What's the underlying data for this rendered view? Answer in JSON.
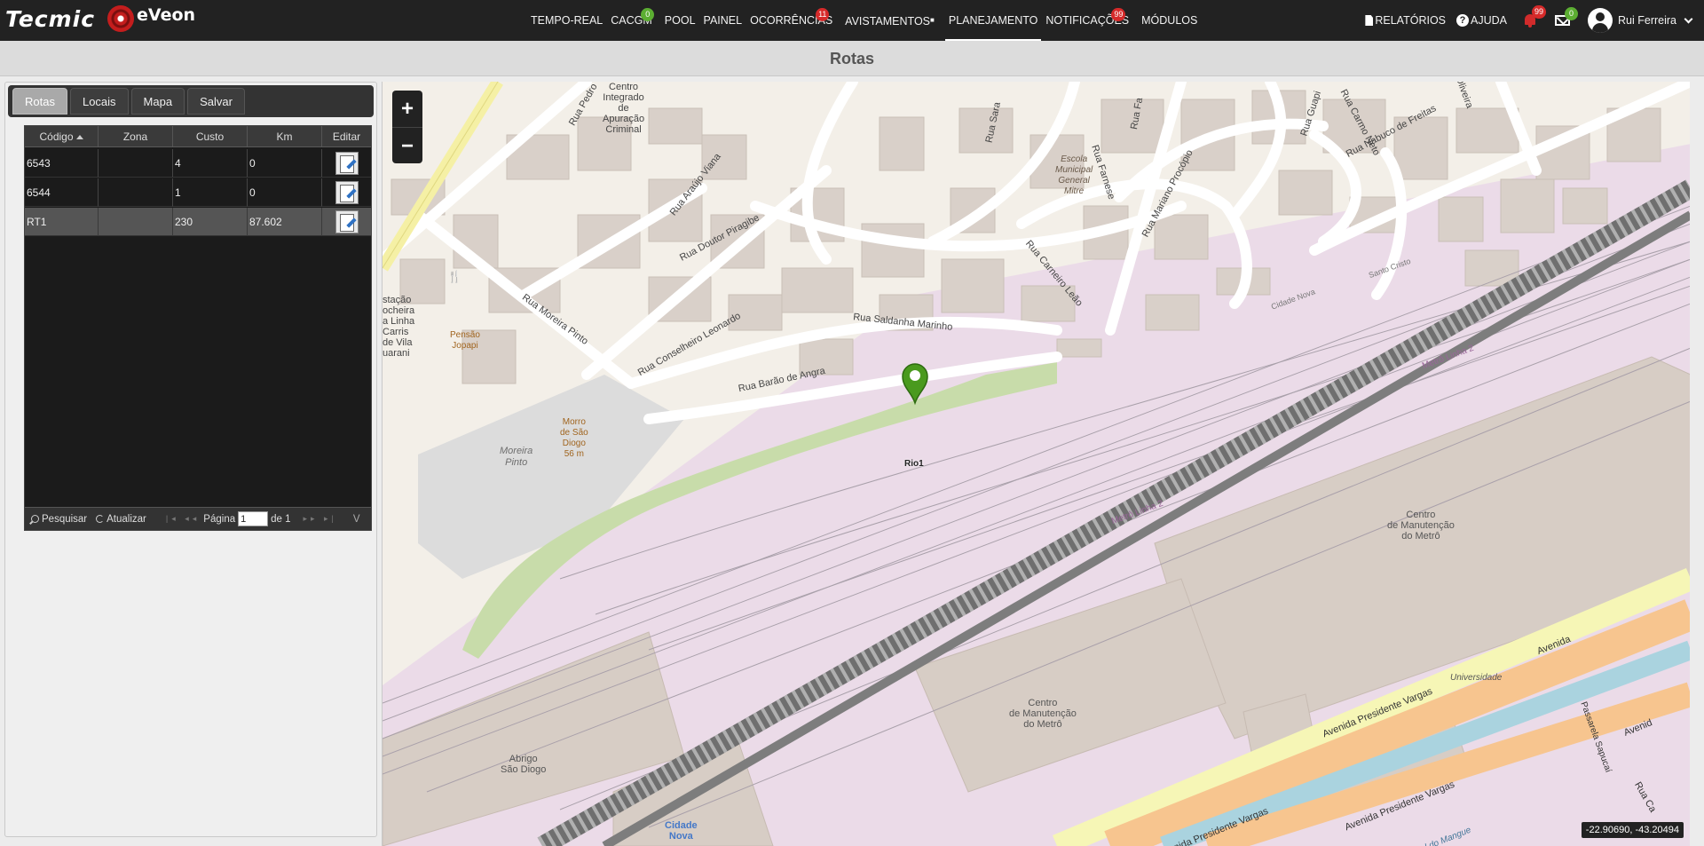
{
  "brand": {
    "tecmic": "Tecmic",
    "eveon": "eVeon"
  },
  "nav": {
    "items": [
      {
        "id": "tempo-real",
        "label": "TEMPO-REAL",
        "badge": ""
      },
      {
        "id": "cacgm",
        "label": "CACGM",
        "badge": "0"
      },
      {
        "id": "pool",
        "label": "POOL",
        "badge": ""
      },
      {
        "id": "painel",
        "label": "PAINEL",
        "badge": ""
      },
      {
        "id": "ocorrencias",
        "label": "OCORRÊNCIAS",
        "badge": "11"
      },
      {
        "id": "avistamentos",
        "label": "AVISTAMENTOS",
        "badge": ""
      },
      {
        "id": "planejamento",
        "label": "PLANEJAMENTO",
        "badge": ""
      },
      {
        "id": "notificacoes",
        "label": "NOTIFICAÇÕES",
        "badge": "99"
      },
      {
        "id": "modulos",
        "label": "MÓDULOS",
        "badge": ""
      }
    ],
    "active": "PLANEJAMENTO",
    "colors": {
      "green_badge": "#5cae32",
      "red_badge": "#d62a2a"
    }
  },
  "user_menu": {
    "relatorios": "RELATÓRIOS",
    "ajuda": "AJUDA",
    "bell_badge": "99",
    "mail_badge": "0",
    "user_name": "Rui Ferreira"
  },
  "page_title": "Rotas",
  "tabs": [
    "Rotas",
    "Locais",
    "Mapa",
    "Salvar"
  ],
  "grid": {
    "columns": [
      "Código",
      "Zona",
      "Custo",
      "Km",
      "Editar"
    ],
    "sort_column": "Código",
    "rows": [
      {
        "codigo": "6543",
        "zona": "",
        "custo": "4",
        "km": "0"
      },
      {
        "codigo": "6544",
        "zona": "",
        "custo": "1",
        "km": "0"
      },
      {
        "codigo": "RT1",
        "zona": "",
        "custo": "230",
        "km": "87.602"
      }
    ],
    "selected_row": "RT1",
    "footer": {
      "search_label": "Pesquisar",
      "refresh_label": "Atualizar",
      "page_label": "Página",
      "page_value": "1",
      "page_of": "de 1",
      "trailing": "V"
    }
  },
  "map": {
    "zoom_in": "+",
    "zoom_out": "−",
    "marker_label": "Rio1",
    "coordinates": "-22.90690, -43.20494",
    "labels": {
      "centro_integrado": "Centro\nIntegrado\nde\nApuração\nCriminal",
      "rua_pedro": "Rua Pedro",
      "rua_araujo_viana": "Rua Araújo Viana",
      "rua_sara": "Rua Sara",
      "rua_guapi": "Rua Guapi",
      "rua_carmo_neto": "Rua Carmo Neto",
      "rua_nabuco": "Rua Nabuco de Freitas",
      "oliveira": "Oliveira",
      "rua_fa": "Rua Fa",
      "escola": "Escola\nMunicipal\nGeneral\nMitre",
      "rua_farnese": "Rua Farnese",
      "rua_mariano": "Rua Mariano Procópio",
      "rua_carneiro": "Rua Carneiro Leão",
      "rua_doutor_piragibe": "Rua Doutor Piragibe",
      "rua_moreira_pinto": "Rua Moreira Pinto",
      "rua_conselheiro": "Rua Conselheiro Leonardo",
      "rua_saldanha": "Rua Saldanha Marinho",
      "rua_barao": "Rua Barão de Angra",
      "estacao": "stação\nocheira\na Linha\nCarris\nde Vila\nuarani",
      "pensao": "Pensão\nJopapi",
      "morro": "Morro\nde São\nDiogo\n56 m",
      "moreira_pinto": "Moreira\nPinto",
      "santo_cristo": "Santo Cristo",
      "cidade_nova_line": "Cidade Nova",
      "metro_linha2": "Metrô Linha 2",
      "metro_linha2b": "Metrô Linha 2",
      "centro_manut1": "Centro\nde Manutenção\ndo Metrô",
      "centro_manut2": "Centro\nde Manutenção\ndo Metrô",
      "universidade": "Universidade",
      "av_presidente_vargas": "Avenida Presidente Vargas",
      "av_presidente_vargas2": "Avenida Presidente Vargas",
      "av_presidente_vargas3": "Avenida Presidente Vargas",
      "passarela": "Passarela Sapucaí",
      "abrigo": "Abrigo\nSão Diogo",
      "cidade_nova": "Cidade\nNova",
      "avenida": "Avenida",
      "avenid_r": "Avenid",
      "canal": "Canal do Mangue",
      "rua_ca": "Rua Ca"
    },
    "colors": {
      "land": "#f3efe8",
      "rail_area": "#ebdbe8",
      "park": "#c8dcaa",
      "buildings": "#d9d0c9",
      "marker": "#4a9a1e",
      "avenue": "#f7c58f",
      "canal": "#aad3df"
    }
  }
}
